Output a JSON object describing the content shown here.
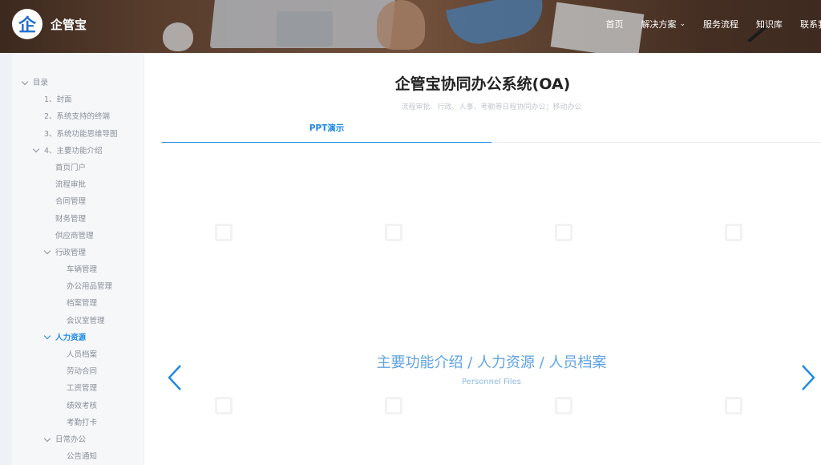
{
  "header": {
    "logo_glyph": "企",
    "brand": "企管宝",
    "nav": [
      {
        "label": "首页",
        "dropdown": false
      },
      {
        "label": "解决方案",
        "dropdown": true
      },
      {
        "label": "服务流程",
        "dropdown": false
      },
      {
        "label": "知识库",
        "dropdown": false
      },
      {
        "label": "联系我们",
        "dropdown": false
      }
    ]
  },
  "sidebar": {
    "items": [
      {
        "label": "目录",
        "level": 0,
        "expanded": true
      },
      {
        "label": "1、封面",
        "level": 1
      },
      {
        "label": "2、系统支持的终端",
        "level": 1
      },
      {
        "label": "3、系统功能思维导图",
        "level": 1
      },
      {
        "label": "4、主要功能介绍",
        "level": 1,
        "expanded": true
      },
      {
        "label": "首页门户",
        "level": 2
      },
      {
        "label": "流程审批",
        "level": 2
      },
      {
        "label": "合同管理",
        "level": 2
      },
      {
        "label": "财务管理",
        "level": 2
      },
      {
        "label": "供应商管理",
        "level": 2
      },
      {
        "label": "行政管理",
        "level": 2,
        "expanded": true
      },
      {
        "label": "车辆管理",
        "level": 3
      },
      {
        "label": "办公用品管理",
        "level": 3
      },
      {
        "label": "档案管理",
        "level": 3
      },
      {
        "label": "会议室管理",
        "level": 3
      },
      {
        "label": "人力资源",
        "level": 2,
        "expanded": true,
        "active": true
      },
      {
        "label": "人员档案",
        "level": 3
      },
      {
        "label": "劳动合同",
        "level": 3
      },
      {
        "label": "工资管理",
        "level": 3
      },
      {
        "label": "绩效考核",
        "level": 3
      },
      {
        "label": "考勤打卡",
        "level": 3
      },
      {
        "label": "日常办公",
        "level": 2,
        "expanded": true
      },
      {
        "label": "公告通知",
        "level": 3
      }
    ]
  },
  "main": {
    "title": "企管宝协同办公系统(OA)",
    "subtitle": "流程审批、行政、人事、考勤等日程协同办公；移动办公",
    "tab_label": "PPT演示",
    "slide_title": "主要功能介绍 / 人力资源 / 人员档案",
    "slide_subtitle": "Personnel Files"
  },
  "colors": {
    "accent": "#1e88e5",
    "slide_text": "#5fa3e6",
    "sidebar_bg": "#f5f7f9",
    "sidebar_text": "#8a9099"
  },
  "icons": {
    "prev": "chevron-left-icon",
    "next": "chevron-right-icon",
    "expand": "chevron-down-icon"
  }
}
